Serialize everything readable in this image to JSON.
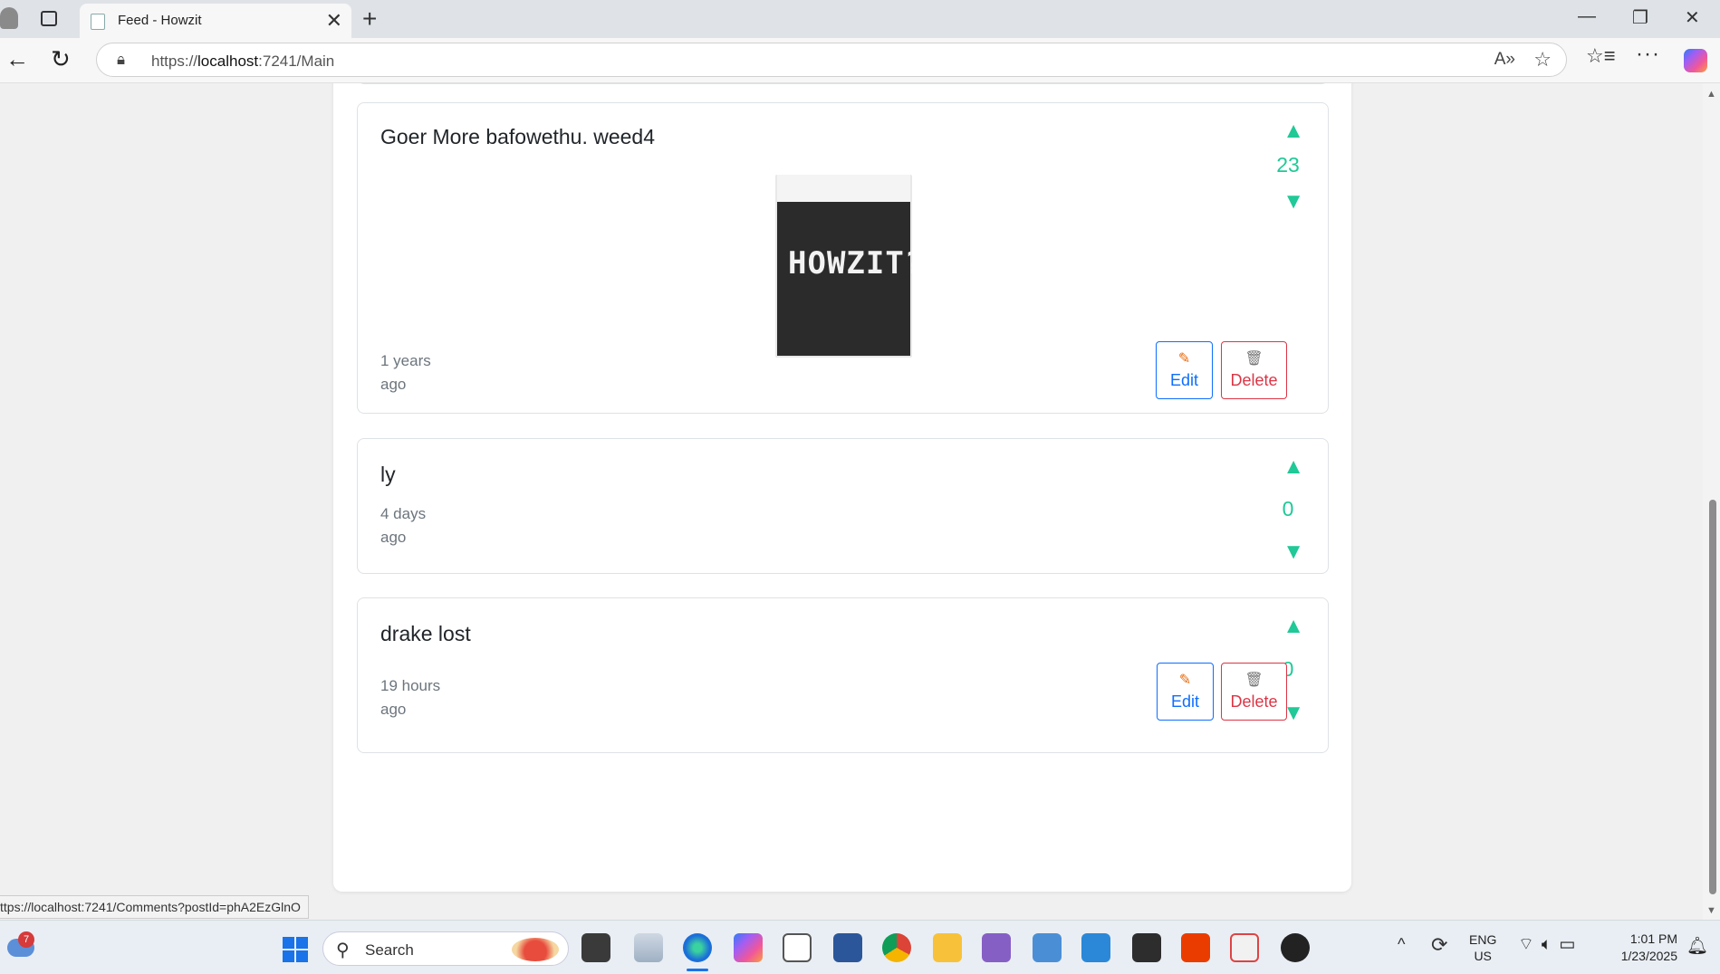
{
  "browser": {
    "tab_title": "Feed - Howzit",
    "tab_close": "✕",
    "new_tab": "+",
    "url_prefix": "https://",
    "url_host": "localhost",
    "url_rest": ":7241/Main",
    "status_url": "ttps://localhost:7241/Comments?postId=phA2EzGlnO",
    "window_minimize": "—",
    "window_restore": "❐",
    "window_close": "✕"
  },
  "feed": {
    "posts": [
      {
        "title": "Goer More bafowethu. weed4",
        "image_text": "HOWZIT?",
        "time_line1": "1 years",
        "time_line2": "ago",
        "votes": "23",
        "edit_label": "Edit",
        "delete_label": "Delete"
      },
      {
        "title": "ly",
        "time_line1": "4 days",
        "time_line2": "ago",
        "votes": "0"
      },
      {
        "title": "drake lost",
        "time_line1": "19 hours",
        "time_line2": "ago",
        "votes": "0",
        "edit_label": "Edit",
        "delete_label": "Delete"
      }
    ],
    "upvote_glyph": "▲",
    "downvote_glyph": "▼"
  },
  "taskbar": {
    "weather_badge": "7",
    "search_label": "Search",
    "lang_line1": "ENG",
    "lang_line2": "US",
    "time": "1:01 PM",
    "date": "1/23/2025"
  },
  "colors": {
    "vote": "#20c997",
    "edit": "#0d6efd",
    "delete": "#dc3545"
  }
}
